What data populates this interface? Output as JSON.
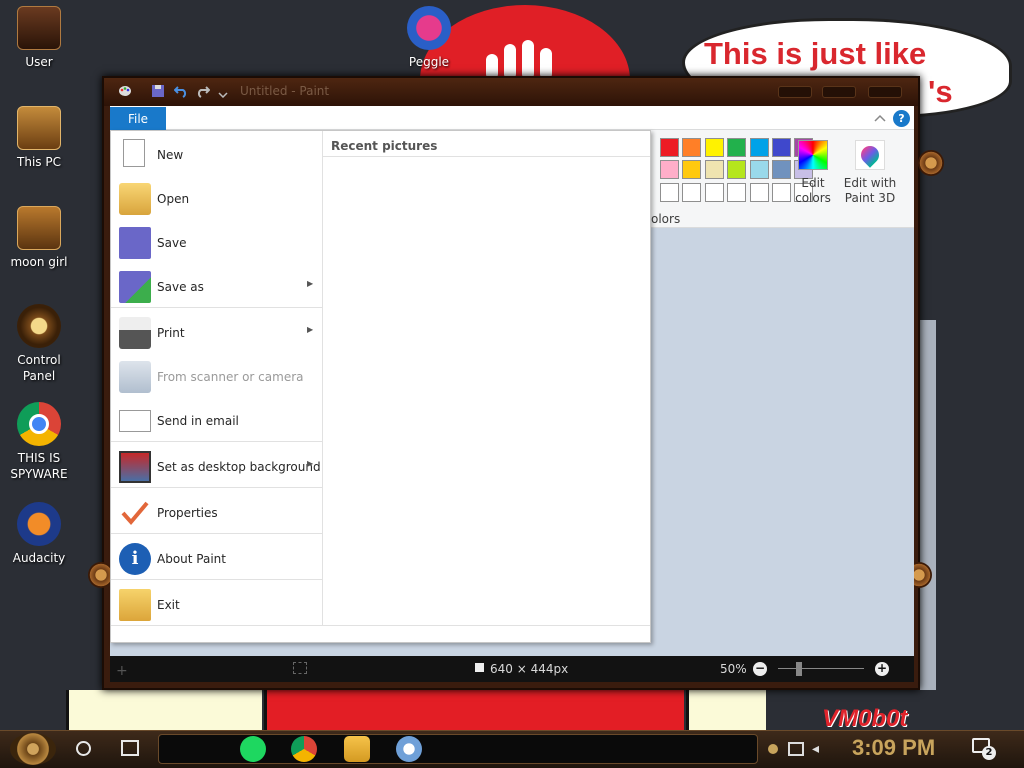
{
  "wallpaper": {
    "bubble_text_line1": "This is just like",
    "bubble_text_line2": "'s",
    "watermark": "VM0b0t"
  },
  "desktop": {
    "icons": [
      {
        "label": "User",
        "icon": "user-folder-icon"
      },
      {
        "label": "Peggle",
        "icon": "peggle-icon"
      },
      {
        "label": "This PC",
        "icon": "computer-icon"
      },
      {
        "label": "moon girl",
        "icon": "folder-icon"
      },
      {
        "label": "Control Panel",
        "icon": "control-panel-icon"
      },
      {
        "label": "THIS IS SPYWARE",
        "icon": "chrome-icon"
      },
      {
        "label": "Audacity",
        "icon": "audacity-icon"
      }
    ]
  },
  "paint": {
    "title": "Untitled - Paint",
    "file_tab": "File",
    "ribbon": {
      "edit_colors": "Edit colors",
      "edit_with_paint3d": "Edit with Paint 3D",
      "colors_group": "olors"
    },
    "colors": {
      "row1": [
        "#ed1c24",
        "#ff7f27",
        "#fff200",
        "#22b14c",
        "#00a2e8",
        "#3f48cc",
        "#a349a4"
      ],
      "row2": [
        "#ffaec9",
        "#ffc90e",
        "#efe4b0",
        "#b5e61d",
        "#99d9ea",
        "#7092be",
        "#c8bfe7"
      ],
      "row3": [
        "#ffffff",
        "#ffffff",
        "#ffffff",
        "#ffffff",
        "#ffffff",
        "#ffffff",
        "#ffffff"
      ]
    },
    "status": {
      "dimensions": "640 × 444px",
      "zoom": "50%"
    }
  },
  "file_menu": {
    "items": [
      {
        "label": "New",
        "icon": "new-document-icon",
        "has_submenu": false,
        "disabled": false
      },
      {
        "label": "Open",
        "icon": "open-folder-icon",
        "has_submenu": false,
        "disabled": false
      },
      {
        "label": "Save",
        "icon": "save-icon",
        "has_submenu": false,
        "disabled": false
      },
      {
        "label": "Save as",
        "icon": "save-as-icon",
        "has_submenu": true,
        "disabled": false
      },
      {
        "label": "Print",
        "icon": "printer-icon",
        "has_submenu": true,
        "disabled": false
      },
      {
        "label": "From scanner or camera",
        "icon": "scanner-icon",
        "has_submenu": false,
        "disabled": true
      },
      {
        "label": "Send in email",
        "icon": "email-icon",
        "has_submenu": false,
        "disabled": false
      },
      {
        "label": "Set as desktop background",
        "icon": "desktop-background-icon",
        "has_submenu": true,
        "disabled": false
      },
      {
        "label": "Properties",
        "icon": "checkmark-icon",
        "has_submenu": false,
        "disabled": false
      },
      {
        "label": "About Paint",
        "icon": "info-icon",
        "has_submenu": false,
        "disabled": false
      },
      {
        "label": "Exit",
        "icon": "exit-icon",
        "has_submenu": false,
        "disabled": false
      }
    ],
    "recent_header": "Recent pictures"
  },
  "taskbar": {
    "time": "3:09 PM",
    "notification_count": "2"
  }
}
